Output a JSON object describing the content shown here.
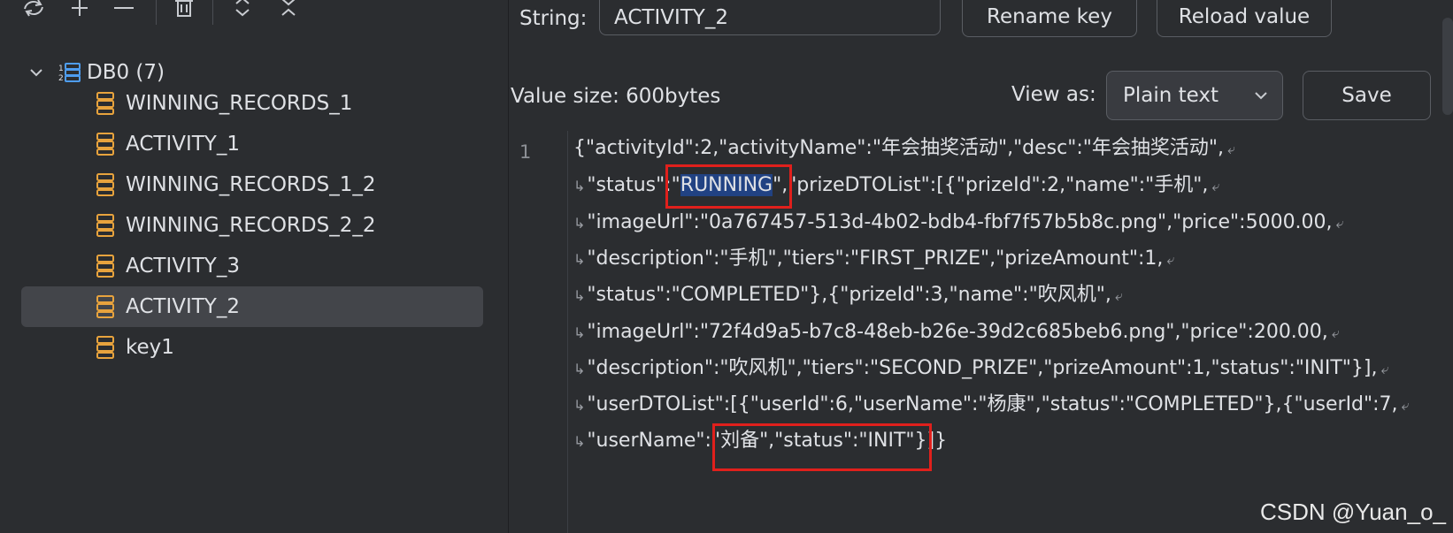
{
  "toolbar": {
    "icons": [
      "refresh-icon",
      "add-icon",
      "remove-icon",
      "delete-icon",
      "expand-icon",
      "collapse-icon"
    ]
  },
  "tree": {
    "db_label": "DB0 (7)",
    "keys": [
      {
        "label": "WINNING_RECORDS_1",
        "selected": false
      },
      {
        "label": "ACTIVITY_1",
        "selected": false
      },
      {
        "label": "WINNING_RECORDS_1_2",
        "selected": false
      },
      {
        "label": "WINNING_RECORDS_2_2",
        "selected": false
      },
      {
        "label": "ACTIVITY_3",
        "selected": false
      },
      {
        "label": "ACTIVITY_2",
        "selected": true
      },
      {
        "label": "key1",
        "selected": false
      }
    ]
  },
  "detail": {
    "type_label": "String:",
    "key_name": "ACTIVITY_2",
    "rename_label": "Rename key",
    "reload_label": "Reload value",
    "value_size": "Value size: 600bytes",
    "view_as_label": "View as:",
    "view_as_value": "Plain text",
    "save_label": "Save"
  },
  "editor": {
    "line_number": "1",
    "lines": [
      "{\"activityId\":2,\"activityName\":\"年会抽奖活动\",\"desc\":\"年会抽奖活动\",",
      "\"status\":\"RUNNING\",\"prizeDTOList\":[{\"prizeId\":2,\"name\":\"手机\",",
      "\"imageUrl\":\"0a767457-513d-4b02-bdb4-fbf7f57b5b8c.png\",\"price\":5000.00,",
      "\"description\":\"手机\",\"tiers\":\"FIRST_PRIZE\",\"prizeAmount\":1,",
      "\"status\":\"COMPLETED\"},{\"prizeId\":3,\"name\":\"吹风机\",",
      "\"imageUrl\":\"72f4d9a5-b7c8-48eb-b26e-39d2c685beb6.png\",\"price\":200.00,",
      "\"description\":\"吹风机\",\"tiers\":\"SECOND_PRIZE\",\"prizeAmount\":1,\"status\":\"INIT\"}],",
      "\"userDTOList\":[{\"userId\":6,\"userName\":\"杨康\",\"status\":\"COMPLETED\"},{\"userId\":7,",
      "\"userName\":\"刘备\",\"status\":\"INIT\"}]}"
    ],
    "line2_pre": "\"status\":\"",
    "line2_hl": "RUNNING",
    "line2_post": "\",\"prizeDTOList\":[{\"prizeId\":2,\"name\":\"手机\","
  },
  "watermark": "CSDN @Yuan_o_"
}
